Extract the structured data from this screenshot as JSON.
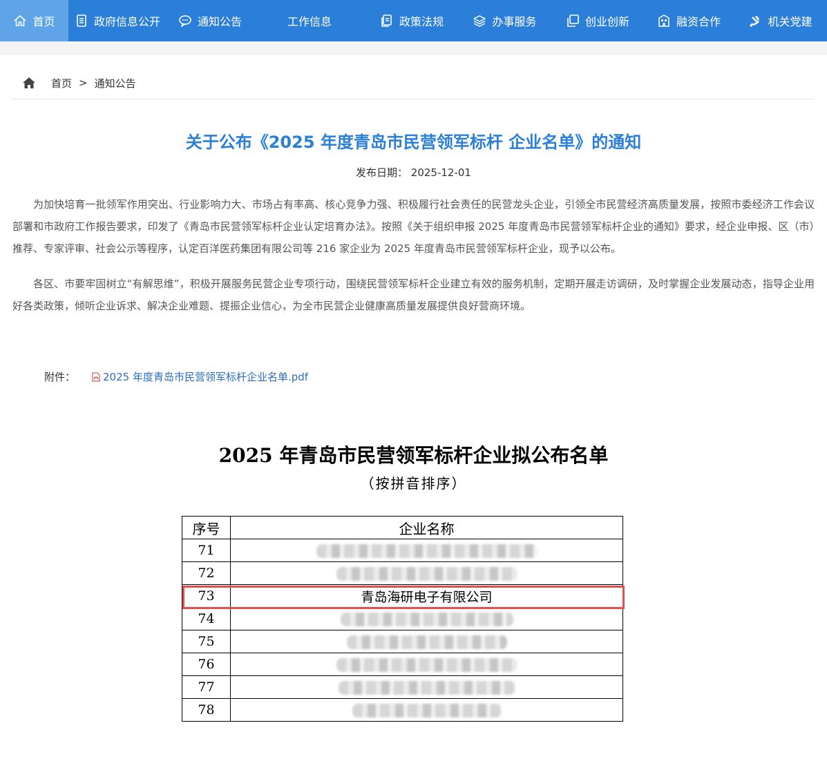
{
  "nav": {
    "items": [
      {
        "label": "首页",
        "icon": "home-icon"
      },
      {
        "label": "政府信息公开",
        "icon": "document-icon"
      },
      {
        "label": "通知公告",
        "icon": "chat-icon"
      },
      {
        "label": "工作信息",
        "icon": ""
      },
      {
        "label": "政策法规",
        "icon": "file-copy-icon"
      },
      {
        "label": "办事服务",
        "icon": "layers-icon"
      },
      {
        "label": "创业创新",
        "icon": "copy-icon"
      },
      {
        "label": "融资合作",
        "icon": "building-icon"
      },
      {
        "label": "机关党建",
        "icon": "party-emblem-icon"
      }
    ],
    "active_index": 0,
    "colors": {
      "bar": "#2b7fd8",
      "active": "#5ea4e6"
    }
  },
  "breadcrumb": {
    "home": "首页",
    "separator": ">",
    "current": "通知公告"
  },
  "article": {
    "title": "关于公布《2025 年度青岛市民营领军标杆 企业名单》的通知",
    "date_label": "发布日期：",
    "date": "2025-12-01",
    "paragraphs": [
      "为加快培育一批领军作用突出、行业影响力大、市场占有率高、核心竞争力强、积极履行社会责任的民营龙头企业，引领全市民营经济高质量发展，按照市委经济工作会议部署和市政府工作报告要求，印发了《青岛市民营领军标杆企业认定培育办法》。按照《关于组织申报 2025 年度青岛市民营领军标杆企业的通知》要求，经企业申报、区（市）推荐、专家评审、社会公示等程序，认定百洋医药集团有限公司等 216 家企业为 2025 年度青岛市民营领军标杆企业，现予以公布。",
      "各区、市要牢固树立“有解思维”，积极开展服务民营企业专项行动，围绕民营领军标杆企业建立有效的服务机制，定期开展走访调研，及时掌握企业发展动态，指导企业用好各类政策，倾听企业诉求、解决企业难题、提振企业信心，为全市民营企业健康高质量发展提供良好营商环境。"
    ],
    "attachment": {
      "label": "附件：",
      "file": "2025 年度青岛市民营领军标杆企业名单.pdf"
    }
  },
  "document": {
    "title": "2025 年青岛市民营领军标杆企业拟公布名单",
    "subtitle": "（按拼音排序）",
    "headers": [
      "序号",
      "企业名称"
    ],
    "rows": [
      {
        "no": "71",
        "name": "",
        "blurred": true
      },
      {
        "no": "72",
        "name": "",
        "blurred": true
      },
      {
        "no": "73",
        "name": "青岛海研电子有限公司",
        "blurred": false,
        "highlighted": true
      },
      {
        "no": "74",
        "name": "",
        "blurred": true
      },
      {
        "no": "75",
        "name": "",
        "blurred": true
      },
      {
        "no": "76",
        "name": "",
        "blurred": true
      },
      {
        "no": "77",
        "name": "",
        "blurred": true
      },
      {
        "no": "78",
        "name": "",
        "blurred": true
      }
    ],
    "highlight_color": "#e0504f"
  }
}
